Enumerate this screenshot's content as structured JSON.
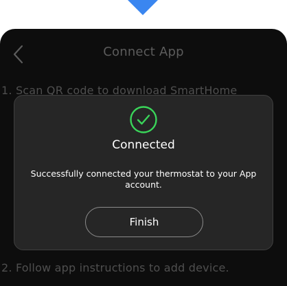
{
  "screen": {
    "title": "Connect App",
    "step_1": "1. Scan QR code to download SmartHome",
    "step_2": "2. Follow app instructions to add device."
  },
  "dialog": {
    "status_icon": "check-circle-icon",
    "title": "Connected",
    "message": "Successfully connected your thermostat to your App account.",
    "finish_label": "Finish"
  },
  "colors": {
    "accent_arrow": "#3a86f0",
    "success": "#3ad65a",
    "dialog_bg": "#262626",
    "screen_bg": "#0d0d0d"
  },
  "icons": {
    "top_arrow": "down-arrow-icon",
    "back": "chevron-left-icon"
  }
}
